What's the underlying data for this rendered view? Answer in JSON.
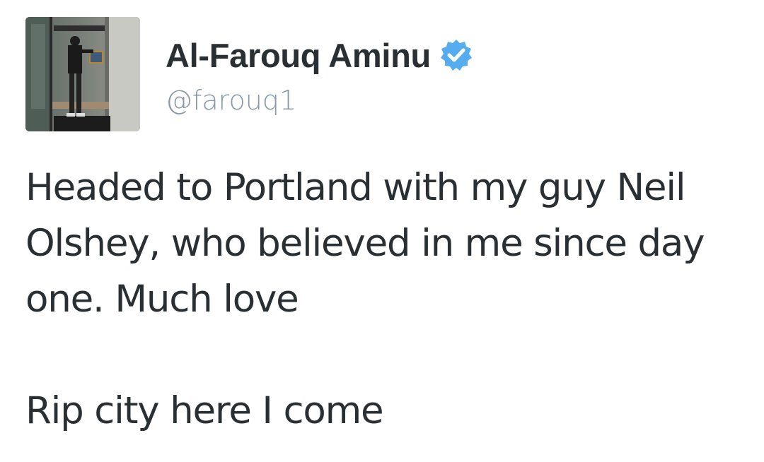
{
  "tweet": {
    "author": {
      "display_name": "Al-Farouq Aminu",
      "handle": "@farouq1",
      "verified": true,
      "avatar_icon": "profile-photo",
      "verified_icon": "verified-badge-icon",
      "verified_color": "#55acee"
    },
    "text_lines": [
      "Headed to Portland with my guy Neil",
      "Olshey, who believed in me since day",
      "one. Much love",
      "Rip city here I come"
    ]
  },
  "colors": {
    "name": "#292f33",
    "handle": "#8899a6",
    "text": "#292f33",
    "background": "#ffffff"
  }
}
